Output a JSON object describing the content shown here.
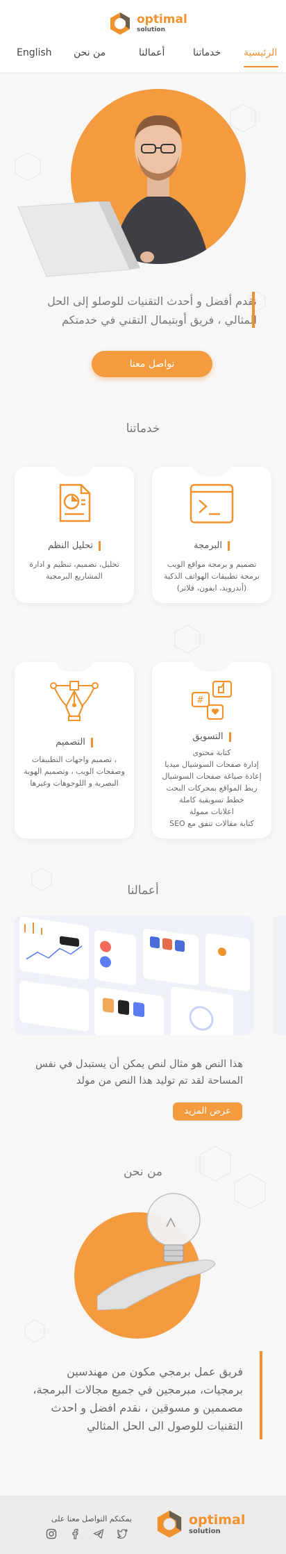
{
  "header": {
    "logo_main": "optimal",
    "logo_sub": "solution",
    "nav": {
      "home": "الرئيسية",
      "services": "خدماتنا",
      "works": "أعمالنا",
      "about": "من نحن",
      "language": "English"
    }
  },
  "hero": {
    "tagline": "نقدم أفضل و أحدث التقنيات للوصلو إلى الحل المثالي ، فريق أوبتيمال التقني في خدمتكم",
    "cta": "تواصل معنا"
  },
  "services": {
    "title": "خدماتنا",
    "items": [
      {
        "title": "البرمجة",
        "desc": "تصميم و برمجة مواقع الويب برمجة تطبيقات الهواتف الذكية (أندرويد، ايفون، فلاتر)",
        "icon": "terminal-icon"
      },
      {
        "title": "تحليل النظم",
        "desc": "تحليل، تصميم، تنظيم و ادارة المشاريع البرمجية",
        "icon": "report-chart-icon"
      },
      {
        "title": "التسويق",
        "lines": [
          "كتابة محتوى",
          "إدارة صفحات السوشيال ميديا",
          "إعادة صياغة صفحات السوشيال",
          "ربط المواقع بمحركات البحث",
          "خطط تسويقية كاملة",
          "اعلانات ممولة",
          "كتابة مقالات تتفق مع SEO"
        ],
        "icon": "social-marketing-icon"
      },
      {
        "title": "التصميم",
        "desc": "، تصميم واجهات التطبيقات وصفحات الويب ، وتصميم الهوية البصرية و اللوجوهات وغيرها",
        "icon": "pen-tool-icon"
      }
    ]
  },
  "works": {
    "title": "أعمالنا",
    "text": "هذا النص هو مثال لنص يمكن أن يستبدل في نفس المساحة لقد تم توليد هذا النص من مولد",
    "more": "عرض المزيد"
  },
  "about": {
    "title": "من نحن",
    "text": "فريق عمل برمجي مكون من مهندسين برمجيات، مبرمجين في جميع مجالات البرمجة، مصممين و مسوقين ، نقدم افضل و احدث التقنيات للوصول الى الحل المثالي"
  },
  "footer": {
    "contact_text": "يمكنكم التواصل معنا على",
    "logo_main": "optimal",
    "logo_sub": "solution",
    "socials": [
      "instagram-icon",
      "facebook-icon",
      "telegram-icon",
      "twitter-icon"
    ]
  },
  "colors": {
    "accent": "#f0922e",
    "accent_light": "#f49a3f",
    "background": "#f7f7f8"
  }
}
